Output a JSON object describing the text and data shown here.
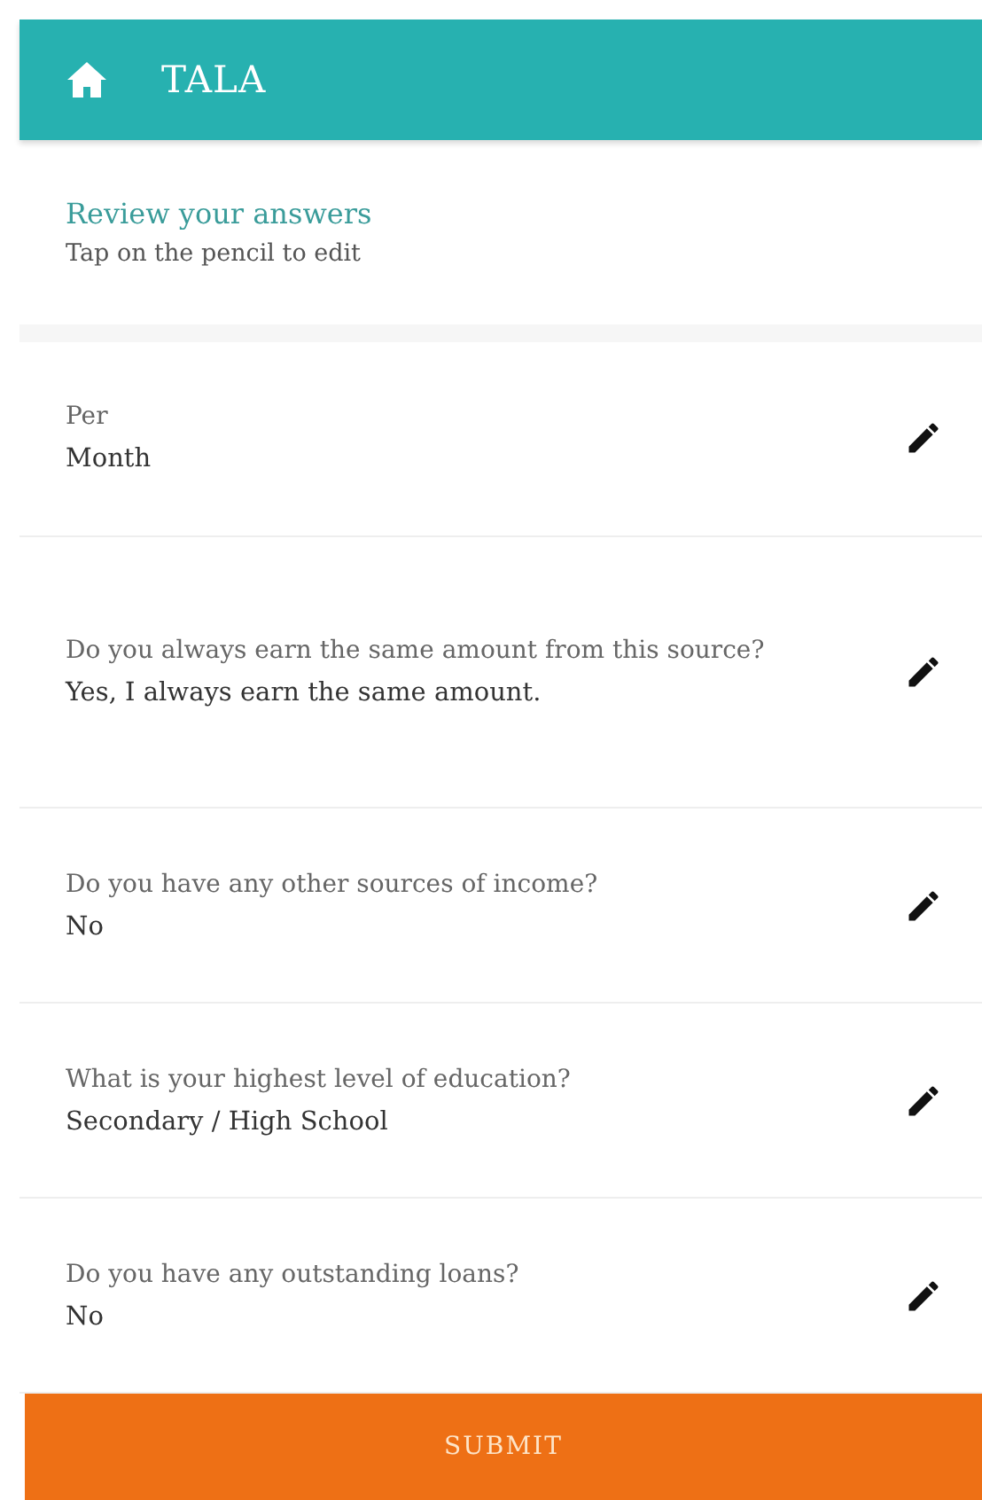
{
  "header": {
    "title": "TALA"
  },
  "intro": {
    "title": "Review your answers",
    "hint": "Tap on the pencil to edit"
  },
  "answers": [
    {
      "question": "Per",
      "answer": "Month"
    },
    {
      "question": "Do you always earn the same amount from this source?",
      "answer": "Yes, I always earn the same amount."
    },
    {
      "question": "Do you have any other sources of income?",
      "answer": "No"
    },
    {
      "question": "What is your highest level of education?",
      "answer": "Secondary / High School"
    },
    {
      "question": "Do you have any outstanding loans?",
      "answer": "No"
    }
  ],
  "submit": {
    "label": "SUBMIT"
  }
}
